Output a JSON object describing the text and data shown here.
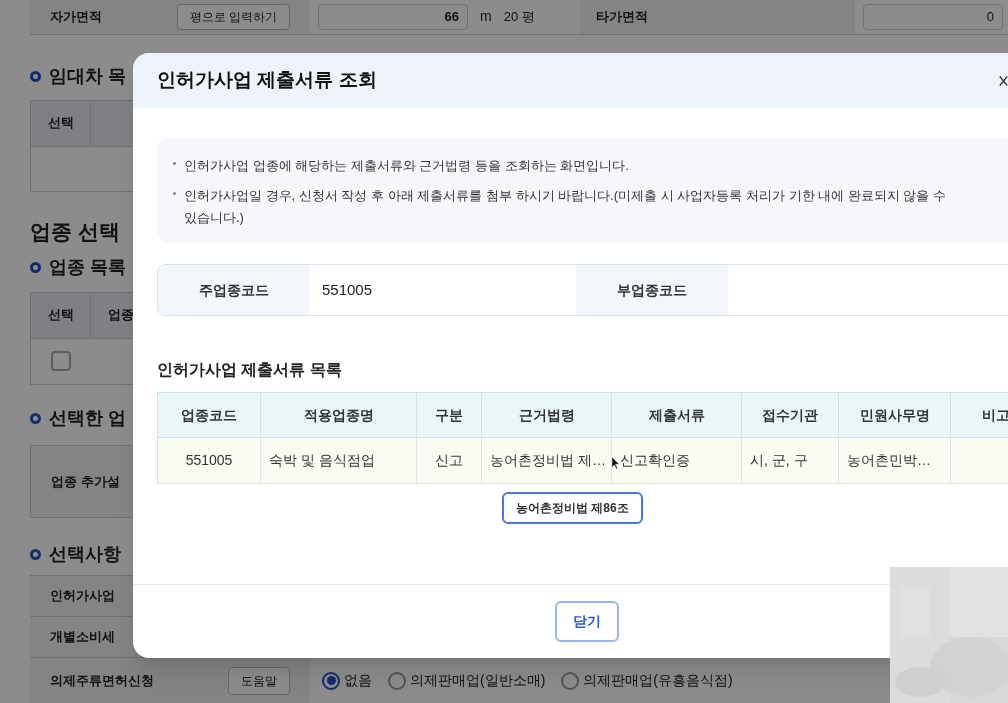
{
  "background_page": {
    "top_row": {
      "label": "자가면적",
      "button": "평으로 입력하기",
      "area_value": "66",
      "area_unit": "m",
      "pyeong": "20 평",
      "label_2": "타가면적",
      "value_2": "0"
    },
    "lease_list": {
      "heading": "임대차 목",
      "columns": [
        "선택"
      ]
    },
    "section_title": "업종 선택",
    "industry_list": {
      "heading": "업종 목록",
      "columns": [
        "선택",
        "업종"
      ],
      "rows": [
        {
          "checked": false
        }
      ]
    },
    "selected_industry": {
      "heading": "선택한 업",
      "label": "업종 추가설"
    },
    "options": {
      "heading": "선택사항",
      "rows": [
        {
          "label": "인허가사업"
        },
        {
          "label": "개별소비세"
        }
      ],
      "liquor": {
        "label": "의제주류면허신청",
        "button": "도움말",
        "choices": [
          {
            "label": "없음",
            "selected": true
          },
          {
            "label": "의제판매업(일반소매)",
            "selected": false
          },
          {
            "label": "의제판매업(유흥음식점)",
            "selected": false
          }
        ]
      }
    }
  },
  "modal": {
    "title": "인허가사업 제출서류 조회",
    "notices": [
      "인허가사업 업종에 해당하는 제출서류와 근거법령 등을 조회하는 화면입니다.",
      "인허가사업일 경우, 신청서 작성 후 아래 제출서류를 첨부 하시기 바랍니다.(미제출 시 사업자등록 처리가 기한 내에 완료되지 않을 수 있습니다.)"
    ],
    "fields": [
      {
        "label": "주업종코드",
        "value": "551005"
      },
      {
        "label": "부업종코드"
      }
    ],
    "list_title": "인허가사업 제출서류 목록",
    "table": {
      "columns": [
        "업종코드",
        "적용업종명",
        "구분",
        "근거법령",
        "제출서류",
        "접수기관",
        "민원사무명",
        "비고"
      ],
      "rows": [
        [
          "551005",
          "숙박 및 음식점업",
          "신고",
          "농어촌정비법 제…",
          "신고확인증",
          "시, 군, 구",
          "농어촌민박…"
        ]
      ]
    },
    "tooltip": "농어촌정비법 제86조",
    "close_button": "닫기"
  }
}
